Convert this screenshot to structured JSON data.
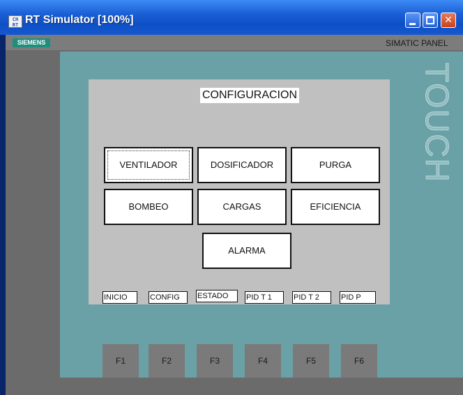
{
  "window": {
    "title": "RT Simulator [100%]",
    "icon_text": "CH RT",
    "buttons": {
      "minimize": "minimize",
      "maximize": "maximize",
      "close": "✕"
    }
  },
  "panel": {
    "brand": "SIEMENS",
    "model": "SIMATIC PANEL",
    "side_text": "TOUCH"
  },
  "screen": {
    "title": "CONFIGURACION",
    "menu_buttons": [
      {
        "label": "VENTILADOR"
      },
      {
        "label": "DOSIFICADOR"
      },
      {
        "label": "PURGA"
      },
      {
        "label": "BOMBEO"
      },
      {
        "label": "CARGAS"
      },
      {
        "label": "EFICIENCIA"
      },
      {
        "label": "ALARMA"
      }
    ],
    "nav_buttons": [
      {
        "label": "INICIO"
      },
      {
        "label": "CONFIG"
      },
      {
        "label": "ESTADO"
      },
      {
        "label": "PID T  1"
      },
      {
        "label": "PID T 2"
      },
      {
        "label": "PID P"
      }
    ]
  },
  "function_keys": [
    "F1",
    "F2",
    "F3",
    "F4",
    "F5",
    "F6"
  ],
  "colors": {
    "titlebar": "#1458d0",
    "bezel": "#6aa1a6",
    "panel": "#6b6b6b",
    "screen": "#c0c0c0",
    "siemens": "#1f8f7d"
  }
}
